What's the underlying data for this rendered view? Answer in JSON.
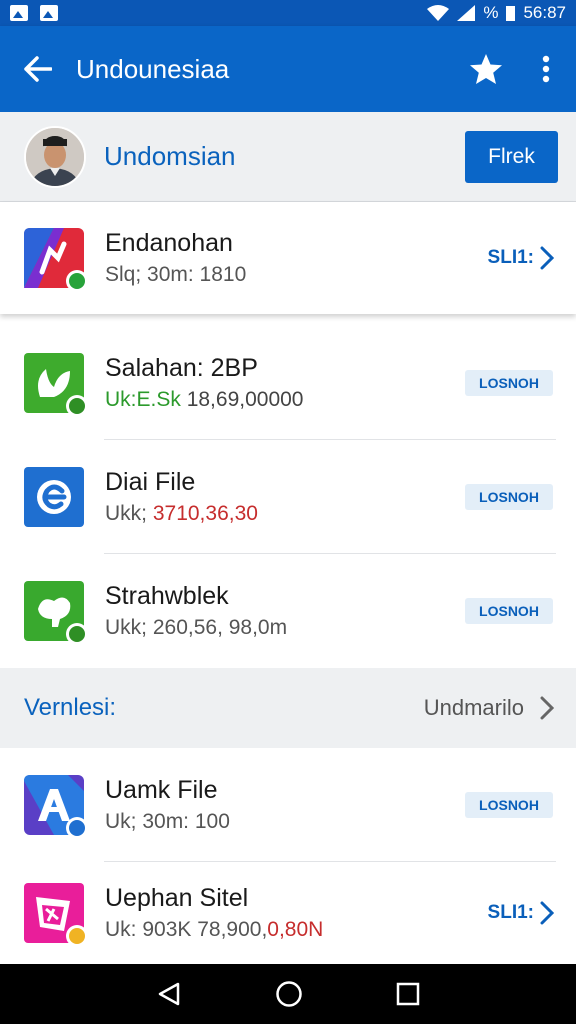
{
  "status_bar": {
    "battery_text": "%",
    "time": "56:87"
  },
  "app_bar": {
    "title": "Undounesiaa"
  },
  "profile": {
    "name": "Undomsian",
    "action_label": "Flrek"
  },
  "featured": {
    "title": "Endanohan",
    "subtitle": "Slq; 30m: 1810",
    "action_label": "SLI1:"
  },
  "list_items": [
    {
      "title": "Salahan: 2BP",
      "sub_prefix": "Uk:E.Sk",
      "sub_value": "18,69,00000",
      "action_label": "LOSNOH"
    },
    {
      "title": "Diai File",
      "sub_prefix": "Ukk;",
      "sub_value": "3710,36,30",
      "action_label": "LOSNOH"
    },
    {
      "title": "Strahwblek",
      "sub_prefix": "Ukk;",
      "sub_value": "260,56, 98,0m",
      "action_label": "LOSNOH"
    }
  ],
  "section": {
    "label": "Vernlesi:",
    "action": "Undmarilo"
  },
  "list2_items": [
    {
      "title": "Uamk File",
      "subtitle": "Uk; 30m: 100",
      "action_label": "LOSNOH"
    },
    {
      "title": "Uephan Sitel",
      "sub_prefix": "Uk: 903K 78,900,",
      "sub_value": "0,80N",
      "action_label": "SLI1:"
    }
  ],
  "colors": {
    "primary": "#0a66c8",
    "status_bar": "#0b57b5",
    "link_blue": "#0a62bd",
    "green": "#2c9a2c",
    "red": "#c62d2d"
  },
  "icons": [
    "back-arrow-icon",
    "star-icon",
    "more-vert-icon",
    "chevron-right-icon",
    "back-triangle-icon",
    "home-circle-icon",
    "recents-square-icon"
  ]
}
